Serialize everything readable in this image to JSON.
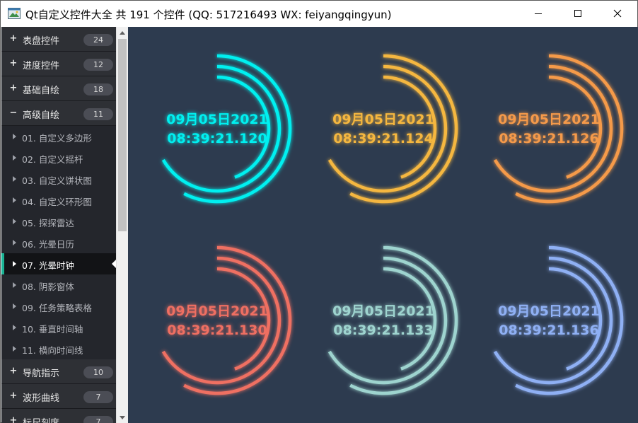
{
  "window": {
    "title": "Qt自定义控件大全 共 191 个控件 (QQ: 517216493 WX: feiyangqingyun)",
    "min_icon": "minimize-icon",
    "max_icon": "maximize-icon",
    "close_icon": "close-icon"
  },
  "sidebar": {
    "groups_top": [
      {
        "label": "表盘控件",
        "count": "24",
        "icon": "+"
      },
      {
        "label": "进度控件",
        "count": "12",
        "icon": "+"
      },
      {
        "label": "基础自绘",
        "count": "18",
        "icon": "+"
      },
      {
        "label": "高级自绘",
        "count": "11",
        "icon": "−"
      }
    ],
    "items": [
      {
        "label": "01. 自定义多边形"
      },
      {
        "label": "02. 自定义摇杆"
      },
      {
        "label": "03. 自定义饼状图"
      },
      {
        "label": "04. 自定义环形图"
      },
      {
        "label": "05. 探探雷达"
      },
      {
        "label": "06. 光晕日历"
      },
      {
        "label": "07. 光晕时钟"
      },
      {
        "label": "08. 阴影窗体"
      },
      {
        "label": "09. 任务策略表格"
      },
      {
        "label": "10. 垂直时间轴"
      },
      {
        "label": "11. 横向时间线"
      }
    ],
    "groups_bottom": [
      {
        "label": "导航指示",
        "count": "10",
        "icon": "+"
      },
      {
        "label": "波形曲线",
        "count": "7",
        "icon": "+"
      },
      {
        "label": "标尺刻度",
        "count": "7",
        "icon": "+"
      }
    ],
    "active_item": "07. 光晕时钟"
  },
  "clocks": [
    {
      "date": "09月05日2021",
      "time": "08:39:21.120",
      "color": "#00f0f0"
    },
    {
      "date": "09月05日2021",
      "time": "08:39:21.124",
      "color": "#f5b73f"
    },
    {
      "date": "09月05日2021",
      "time": "08:39:21.126",
      "color": "#f59a4a"
    },
    {
      "date": "09月05日2021",
      "time": "08:39:21.130",
      "color": "#ef6f62"
    },
    {
      "date": "09月05日2021",
      "time": "08:39:21.133",
      "color": "#9ed4cf"
    },
    {
      "date": "09月05日2021",
      "time": "08:39:21.136",
      "color": "#8fb0f4"
    }
  ],
  "colors": {
    "background": "#2d3b4f",
    "sidebar": "#24262c",
    "accent": "#19b394"
  }
}
